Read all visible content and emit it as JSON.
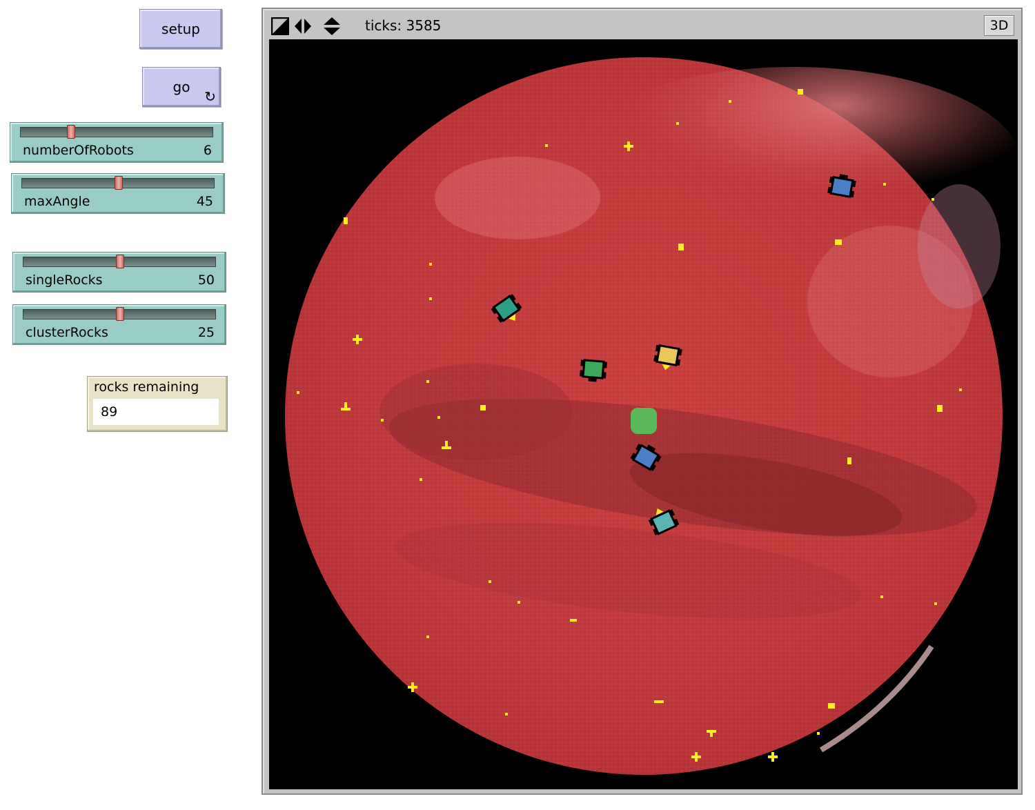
{
  "buttons": {
    "setup": "setup",
    "go": "go",
    "go_forever_icon": "forever-arrows-icon"
  },
  "sliders": [
    {
      "name": "numberOfRobots",
      "value": "6",
      "fraction": 0.26
    },
    {
      "name": "maxAngle",
      "value": "45",
      "fraction": 0.5
    },
    {
      "name": "singleRocks",
      "value": "50",
      "fraction": 0.5
    },
    {
      "name": "clusterRocks",
      "value": "25",
      "fraction": 0.5
    }
  ],
  "monitor": {
    "label": "rocks remaining",
    "value": "89"
  },
  "view": {
    "ticks": "ticks: 3585",
    "button_3d": "3D",
    "toolbar_icons": [
      "zoom-diagonal-icon",
      "horizontal-arrows-icon",
      "vertical-arrows-icon"
    ]
  },
  "colors": {
    "button_bg": "#c8c8f0",
    "slider_bg": "#99ccc4",
    "monitor_bg": "#e8e3c7",
    "planet": "#c0383a",
    "rock": "#ffee22",
    "base": "#5cb85c"
  }
}
